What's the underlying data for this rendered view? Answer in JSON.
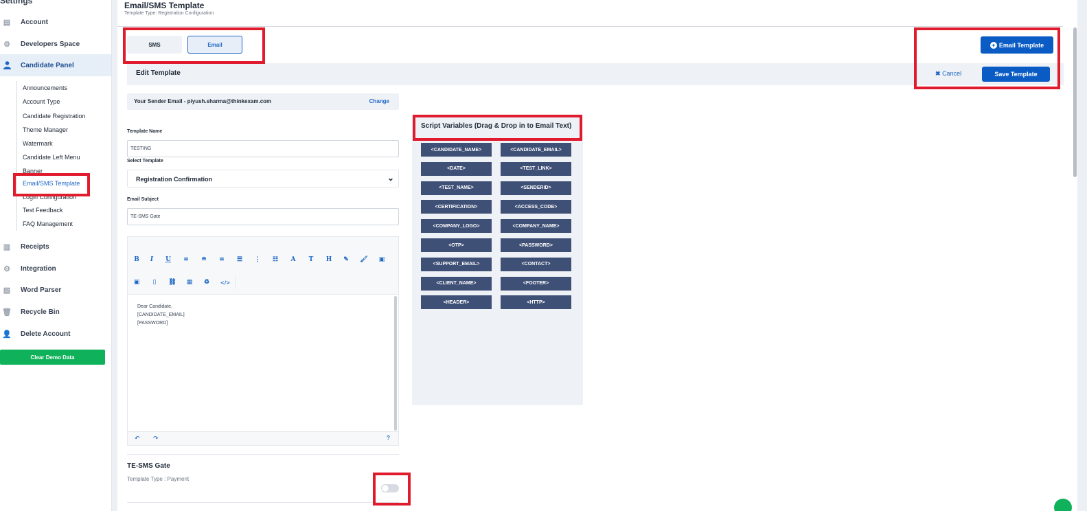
{
  "sidebar": {
    "title": "Settings",
    "top_items": [
      {
        "label": "Account",
        "icon": "building-icon"
      },
      {
        "label": "Developers Space",
        "icon": "gear-icon"
      },
      {
        "label": "Candidate Panel",
        "icon": "user-icon"
      }
    ],
    "sub_items": [
      {
        "label": "Announcements"
      },
      {
        "label": "Account Type"
      },
      {
        "label": "Candidate Registration"
      },
      {
        "label": "Theme Manager"
      },
      {
        "label": "Watermark"
      },
      {
        "label": "Candidate Left Menu"
      },
      {
        "label": "Banner"
      },
      {
        "label": "Email/SMS Template",
        "active": true
      },
      {
        "label": "Login Configuration"
      },
      {
        "label": "Test Feedback"
      },
      {
        "label": "FAQ Management"
      }
    ],
    "bottom_items": [
      {
        "label": "Receipts",
        "icon": "receipt-icon"
      },
      {
        "label": "Integration",
        "icon": "gear-icon"
      },
      {
        "label": "Word Parser",
        "icon": "document-icon"
      },
      {
        "label": "Recycle Bin",
        "icon": "trash-icon"
      },
      {
        "label": "Delete Account",
        "icon": "user-remove-icon"
      }
    ],
    "clear_button": "Clear Demo Data"
  },
  "header": {
    "title": "Email/SMS Template",
    "subtitle": "Template Type: Registration Configuration"
  },
  "tabs": {
    "sms": "SMS",
    "email": "Email",
    "active": "Email"
  },
  "actions": {
    "email_template": "Email Template",
    "cancel": "Cancel",
    "save_template": "Save Template"
  },
  "edit": {
    "title": "Edit Template",
    "sender_text": "Your Sender Email - piyush.sharma@thinkexam.com",
    "change_label": "Change"
  },
  "form": {
    "template_name_label": "Template Name",
    "template_name_value": "TESTING",
    "select_template_label": "Select Template",
    "select_template_value": "Registration Confirmation",
    "email_subject_label": "Email Subject",
    "email_subject_value": "TE-SMS Gate"
  },
  "editor": {
    "body_lines": [
      "Dear Candidate,",
      "[CANDIDATE_EMAIL]",
      "[PASSWORD]"
    ]
  },
  "gate": {
    "title": "TE-SMS Gate",
    "type": "Template Type : Payment",
    "enabled": false
  },
  "variables": {
    "title": "Script Variables (Drag & Drop in to Email Text)",
    "items": [
      "<CANDIDATE_NAME>",
      "<CANDIDATE_EMAIL>",
      "<DATE>",
      "<TEST_LINK>",
      "<TEST_NAME>",
      "<SENDERID>",
      "<CERTIFICATION>",
      "<ACCESS_CODE>",
      "<COMPANY_LOGO>",
      "<COMPANY_NAME>",
      "<OTP>",
      "<PASSWORD>",
      "<SUPPORT_EMAIL>",
      "<CONTACT>",
      "<CLIENT_NAME>",
      "<FOOTER>",
      "<HEADER>",
      "<HTTP>"
    ]
  },
  "colors": {
    "primary": "#0a5bc4",
    "chip": "#3f5077",
    "highlight": "#e01b2d",
    "success": "#0fb25a"
  }
}
